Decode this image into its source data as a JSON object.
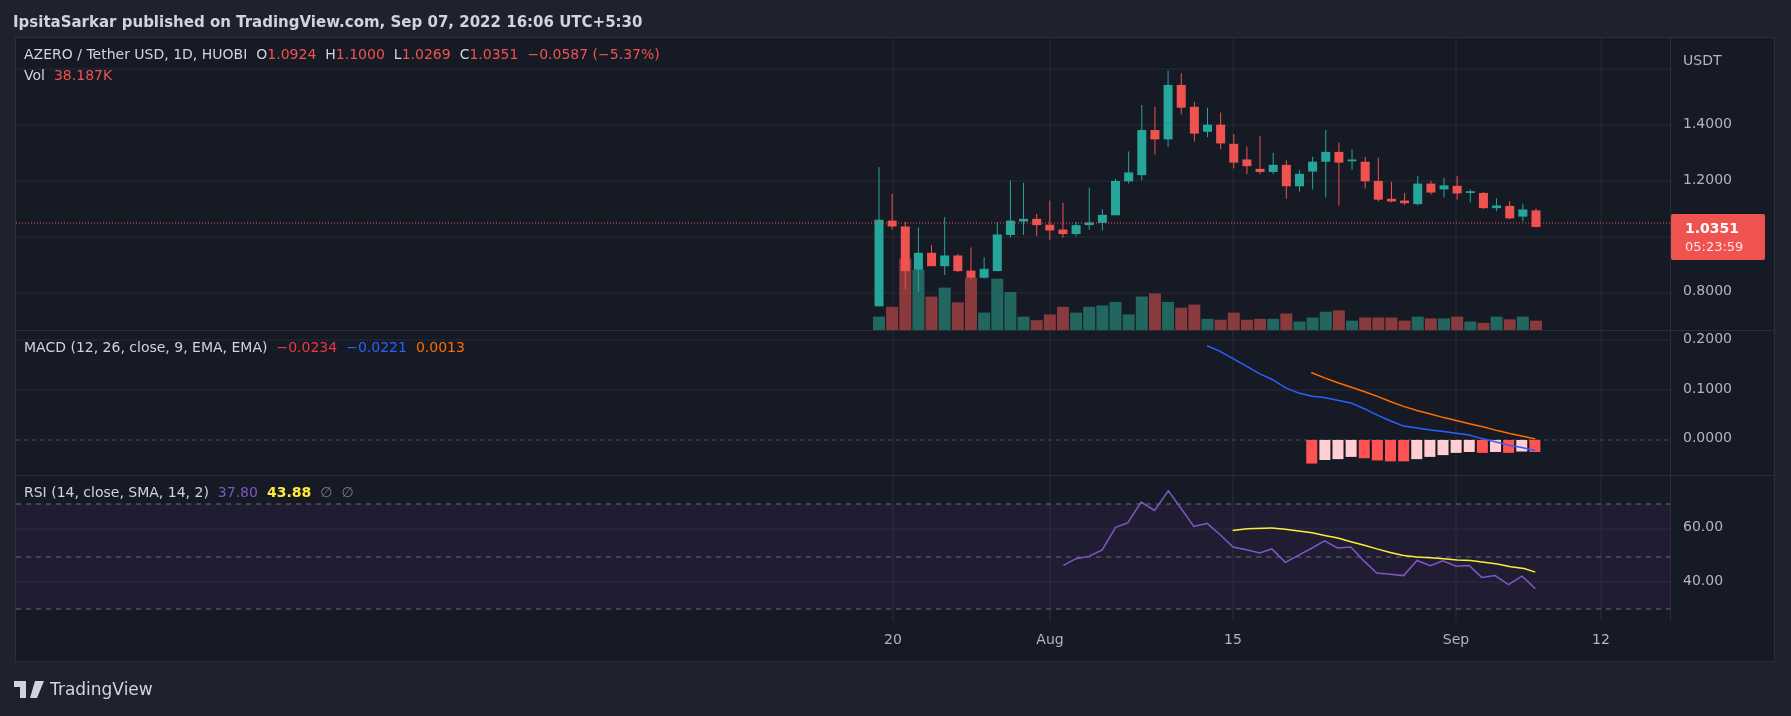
{
  "header": {
    "publisher": "IpsitaSarkar published on TradingView.com, Sep 07, 2022 16:06 UTC+5:30"
  },
  "main_pane": {
    "symbol": "AZERO / Tether USD, 1D, HUOBI",
    "ohlc": [
      {
        "label": "O",
        "value": "1.0924"
      },
      {
        "label": "H",
        "value": "1.1000"
      },
      {
        "label": "L",
        "value": "1.0269"
      },
      {
        "label": "C",
        "value": "1.0351"
      }
    ],
    "change": "−0.0587 (−5.37%)",
    "volume": {
      "label": "Vol",
      "value": "38.187K"
    },
    "currency": "USDT",
    "price_ticks": [
      "1.4000",
      "1.2000",
      "0.8000"
    ],
    "last_price": "1.0351",
    "countdown": "05:23:59"
  },
  "macd_pane": {
    "title": "MACD (12, 26, close, 9, EMA, EMA)",
    "values": [
      {
        "value": "−0.0234",
        "color": "#f23645"
      },
      {
        "value": "−0.0221",
        "color": "#2962ff"
      },
      {
        "value": "0.0013",
        "color": "#ff6d00"
      }
    ],
    "ticks": [
      "0.2000",
      "0.1000",
      "0.0000"
    ]
  },
  "rsi_pane": {
    "title": "RSI (14, close, SMA, 14, 2)",
    "values": [
      {
        "value": "37.80",
        "color": "#7e57c2"
      },
      {
        "value": "43.88",
        "color": "#ffeb3b"
      },
      {
        "value": "∅",
        "color": "#787b86"
      },
      {
        "value": "∅",
        "color": "#787b86"
      }
    ],
    "ticks": [
      "60.00",
      "40.00"
    ]
  },
  "time_axis": [
    "20",
    "Aug",
    "15",
    "Sep",
    "12"
  ],
  "footer": {
    "brand": "TradingView"
  }
}
